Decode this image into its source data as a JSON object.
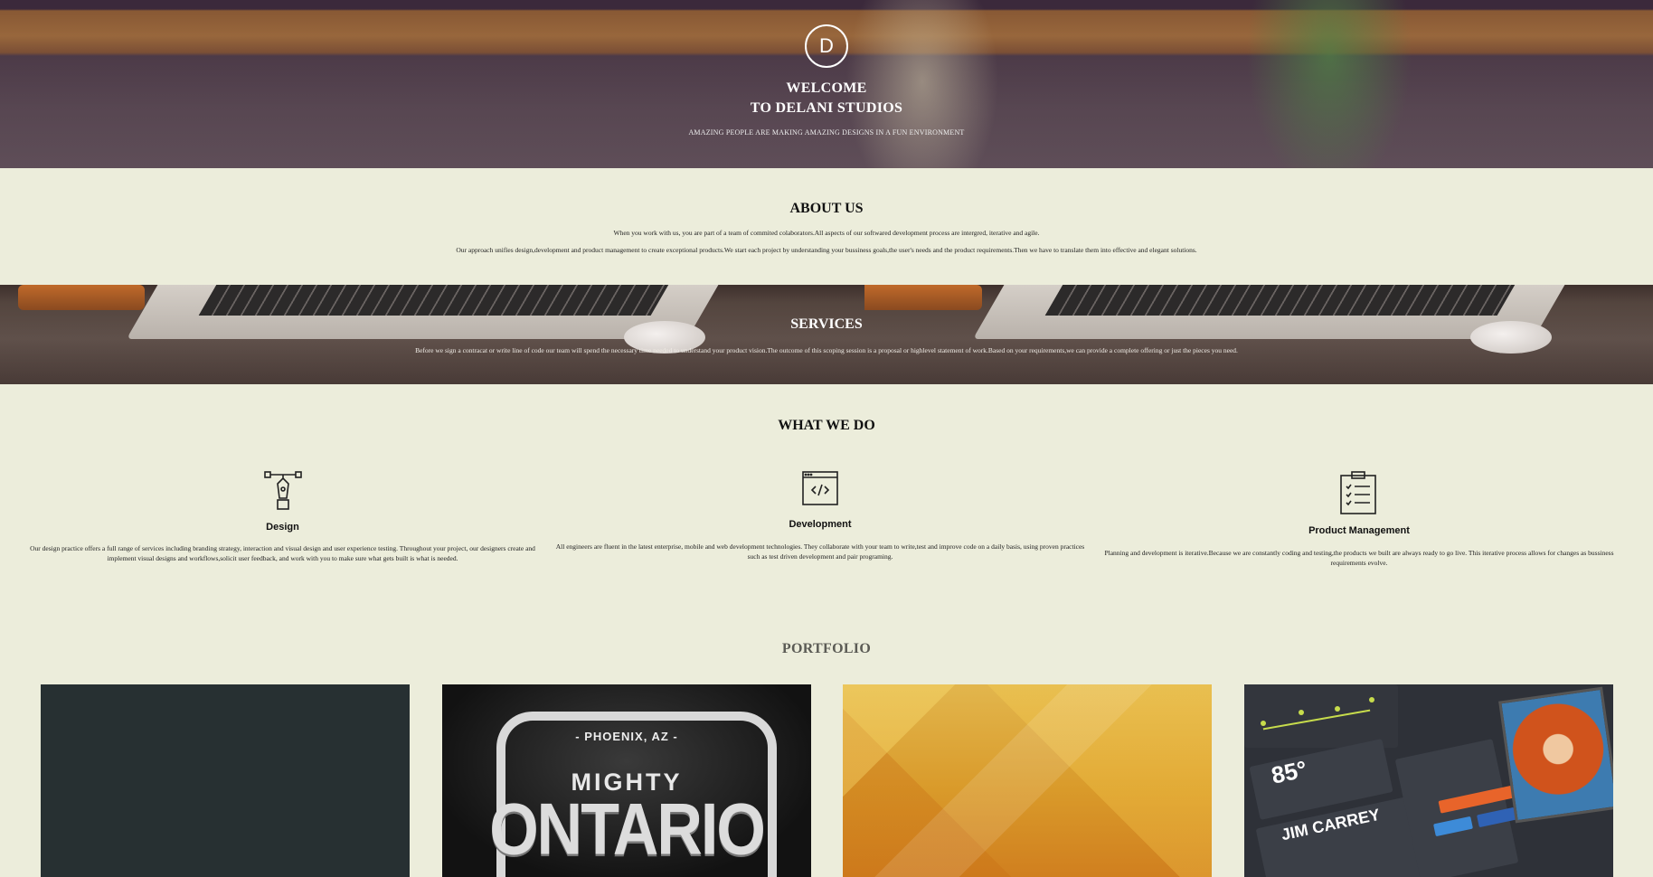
{
  "hero": {
    "logo_letter": "D",
    "title_line1": "WELCOME",
    "title_line2": "TO DELANI STUDIOS",
    "tagline": "AMAZING PEOPLE ARE MAKING AMAZING DESIGNS IN A FUN ENVIRONMENT"
  },
  "about": {
    "title": "ABOUT US",
    "paragraph1": "When you work with us, you are part of a team of commited colaborators.All aspects of our softwared development process are intergred, iterative and agile.",
    "paragraph2": "Our approach unifies design,development and product management to create exceptional products.We start each project by understanding your bussiness goals,the user's needs and the product requirements.Then we have to translate them into effective and elegant solutions."
  },
  "services": {
    "title": "SERVICES",
    "paragraph": "Before we sign a contracat or write line of code our team will spend the necessary time needed to understand your product vision.The outcome of this scoping session is a proposal or highlevel statement of work.Based on your requirements,we can provide a complete offering or just the pieces you need."
  },
  "what_we_do": {
    "title": "WHAT WE DO",
    "items": [
      {
        "icon": "pen-tool-icon",
        "title": "Design",
        "text": "Our design practice offers a full range of services including branding strategy, interaction and visual design and user experience testing. Throughout your project, our designers create and implement visual designs and workflows,solicit user feedback, and work with you to make sure what gets built is what is needed."
      },
      {
        "icon": "code-window-icon",
        "title": "Development",
        "text": "All engineers are fluent in the latest enterprise, mobile and web development technologies. They collaborate with your team to write,test and improve code on a daily basis, using proven practices such as test driven development and pair programing."
      },
      {
        "icon": "clipboard-checklist-icon",
        "title": "Product Management",
        "text": "Planning and development is iterative.Because we are constantly coding and testing,the products we built are always ready to go live. This iterative process allows for changes as bussiness requirements evolve."
      }
    ]
  },
  "portfolio": {
    "title": "PORTFOLIO",
    "badge_sub": "- PHOENIX, AZ -",
    "badge_mighty": "MIGHTY",
    "badge_ontario": "ONTARIO",
    "dash_temp": "85°",
    "dash_name": "JIM CARREY"
  },
  "colors": {
    "page_bg": "#eceddb",
    "dash_accent": "#c7dc4c",
    "dash_orange": "#e8642a",
    "dash_blue": "#3d8bd8"
  }
}
